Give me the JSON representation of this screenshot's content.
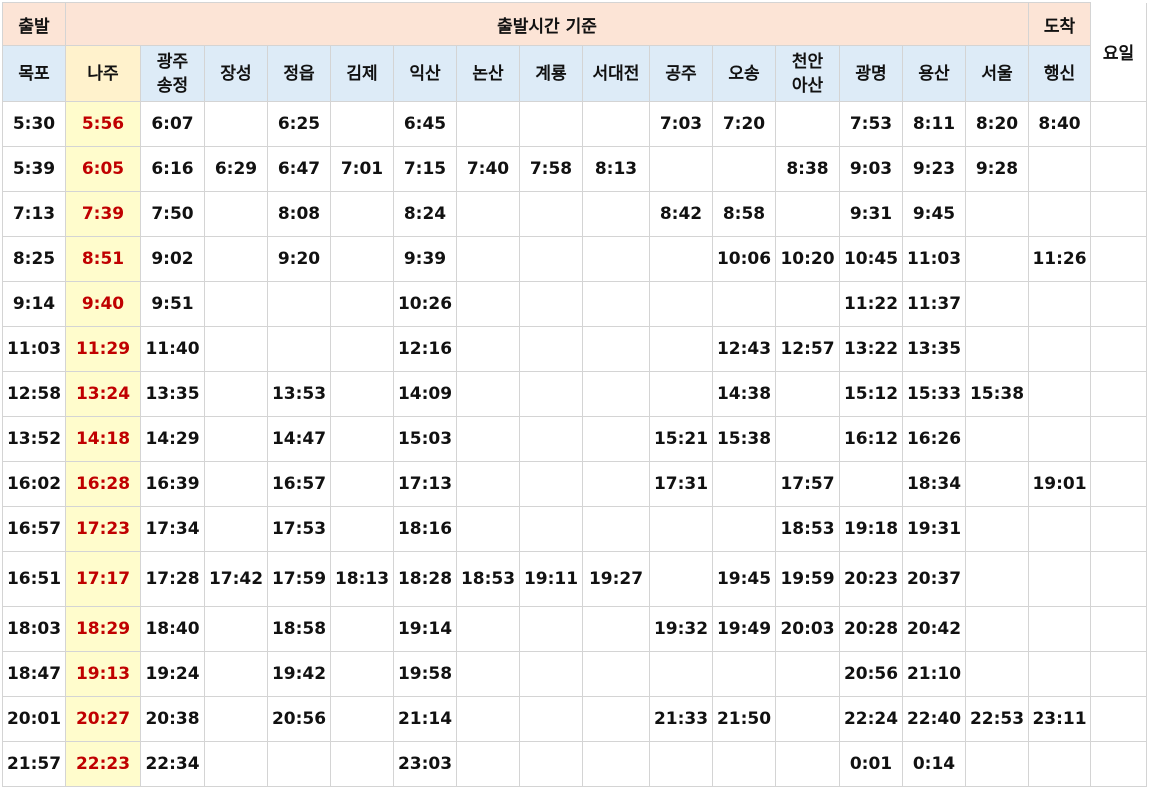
{
  "header": {
    "depart_label": "출발",
    "basis_label": "출발시간 기준",
    "arrive_label": "도착",
    "day_label": "요일"
  },
  "stations": [
    {
      "line1": "목포",
      "line2": ""
    },
    {
      "line1": "나주",
      "line2": ""
    },
    {
      "line1": "광주",
      "line2": "송정"
    },
    {
      "line1": "장성",
      "line2": ""
    },
    {
      "line1": "정읍",
      "line2": ""
    },
    {
      "line1": "김제",
      "line2": ""
    },
    {
      "line1": "익산",
      "line2": ""
    },
    {
      "line1": "논산",
      "line2": ""
    },
    {
      "line1": "계룡",
      "line2": ""
    },
    {
      "line1": "서대전",
      "line2": ""
    },
    {
      "line1": "공주",
      "line2": ""
    },
    {
      "line1": "오송",
      "line2": ""
    },
    {
      "line1": "천안",
      "line2": "아산"
    },
    {
      "line1": "광명",
      "line2": ""
    },
    {
      "line1": "용산",
      "line2": ""
    },
    {
      "line1": "서울",
      "line2": ""
    },
    {
      "line1": "행신",
      "line2": ""
    }
  ],
  "rows": [
    [
      "5:30",
      "5:56",
      "6:07",
      "",
      "6:25",
      "",
      "6:45",
      "",
      "",
      "",
      "7:03",
      "7:20",
      "",
      "7:53",
      "8:11",
      "8:20",
      "8:40"
    ],
    [
      "5:39",
      "6:05",
      "6:16",
      "6:29",
      "6:47",
      "7:01",
      "7:15",
      "7:40",
      "7:58",
      "8:13",
      "",
      "",
      "8:38",
      "9:03",
      "9:23",
      "9:28",
      ""
    ],
    [
      "7:13",
      "7:39",
      "7:50",
      "",
      "8:08",
      "",
      "8:24",
      "",
      "",
      "",
      "8:42",
      "8:58",
      "",
      "9:31",
      "9:45",
      "",
      ""
    ],
    [
      "8:25",
      "8:51",
      "9:02",
      "",
      "9:20",
      "",
      "9:39",
      "",
      "",
      "",
      "",
      "10:06",
      "10:20",
      "10:45",
      "11:03",
      "",
      "11:26"
    ],
    [
      "9:14",
      "9:40",
      "9:51",
      "",
      "",
      "",
      "10:26",
      "",
      "",
      "",
      "",
      "",
      "",
      "11:22",
      "11:37",
      "",
      ""
    ],
    [
      "11:03",
      "11:29",
      "11:40",
      "",
      "",
      "",
      "12:16",
      "",
      "",
      "",
      "",
      "12:43",
      "12:57",
      "13:22",
      "13:35",
      "",
      ""
    ],
    [
      "12:58",
      "13:24",
      "13:35",
      "",
      "13:53",
      "",
      "14:09",
      "",
      "",
      "",
      "",
      "14:38",
      "",
      "15:12",
      "15:33",
      "15:38",
      ""
    ],
    [
      "13:52",
      "14:18",
      "14:29",
      "",
      "14:47",
      "",
      "15:03",
      "",
      "",
      "",
      "15:21",
      "15:38",
      "",
      "16:12",
      "16:26",
      "",
      ""
    ],
    [
      "16:02",
      "16:28",
      "16:39",
      "",
      "16:57",
      "",
      "17:13",
      "",
      "",
      "",
      "17:31",
      "",
      "17:57",
      "",
      "18:34",
      "",
      "19:01"
    ],
    [
      "16:57",
      "17:23",
      "17:34",
      "",
      "17:53",
      "",
      "18:16",
      "",
      "",
      "",
      "",
      "",
      "18:53",
      "19:18",
      "19:31",
      "",
      ""
    ],
    [
      "16:51",
      "17:17",
      "17:28",
      "17:42",
      "17:59",
      "18:13",
      "18:28",
      "18:53",
      "19:11",
      "19:27",
      "",
      "19:45",
      "19:59",
      "20:23",
      "20:37",
      "",
      ""
    ],
    [
      "18:03",
      "18:29",
      "18:40",
      "",
      "18:58",
      "",
      "19:14",
      "",
      "",
      "",
      "19:32",
      "19:49",
      "20:03",
      "20:28",
      "20:42",
      "",
      ""
    ],
    [
      "18:47",
      "19:13",
      "19:24",
      "",
      "19:42",
      "",
      "19:58",
      "",
      "",
      "",
      "",
      "",
      "",
      "20:56",
      "21:10",
      "",
      ""
    ],
    [
      "20:01",
      "20:27",
      "20:38",
      "",
      "20:56",
      "",
      "21:14",
      "",
      "",
      "",
      "21:33",
      "21:50",
      "",
      "22:24",
      "22:40",
      "22:53",
      "23:11"
    ],
    [
      "21:57",
      "22:23",
      "22:34",
      "",
      "",
      "",
      "23:03",
      "",
      "",
      "",
      "",
      "",
      "",
      "0:01",
      "0:14",
      "",
      ""
    ]
  ],
  "colors": {
    "header_top_bg": "#fce4d6",
    "station_header_bg": "#ddebf7",
    "naju_column_bg": "#fffccc",
    "naju_text": "#c00000",
    "grid_border": "#d4d4d4"
  }
}
